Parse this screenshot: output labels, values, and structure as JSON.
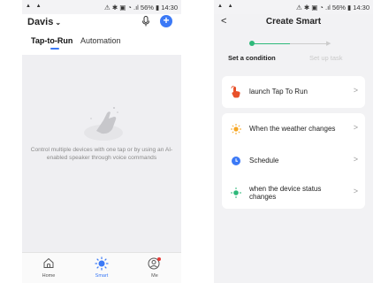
{
  "left": {
    "status": {
      "left": "▲ ▲",
      "right": "⚠ ✱ ▣ ◔ .ıl 56% ▮ 14:30"
    },
    "home_name": "Davis",
    "tabs": [
      {
        "label": "Tap-to-Run"
      },
      {
        "label": "Automation"
      }
    ],
    "more": "···",
    "empty_message": "Control multiple devices with one tap or by using an AI-enabled speaker through voice commands",
    "tabbar": [
      {
        "label": "Home"
      },
      {
        "label": "Smart"
      },
      {
        "label": "Me"
      }
    ]
  },
  "right": {
    "status": {
      "left": "▲ ▲",
      "right": "⚠ ✱ ▣ ◔ .ıl 56% ▮ 14:30"
    },
    "title": "Create Smart",
    "steps": {
      "current": "Set a condition",
      "next": "Set up task"
    },
    "card1": [
      {
        "label": "launch Tap To Run"
      }
    ],
    "card2": [
      {
        "label": "When the weather changes"
      },
      {
        "label": "Schedule"
      },
      {
        "label": "when the device status changes"
      }
    ]
  },
  "colors": {
    "accent": "#3b79f6",
    "progress": "#2eb97a",
    "sun": "#f5a623",
    "hand": "#e8512a"
  }
}
